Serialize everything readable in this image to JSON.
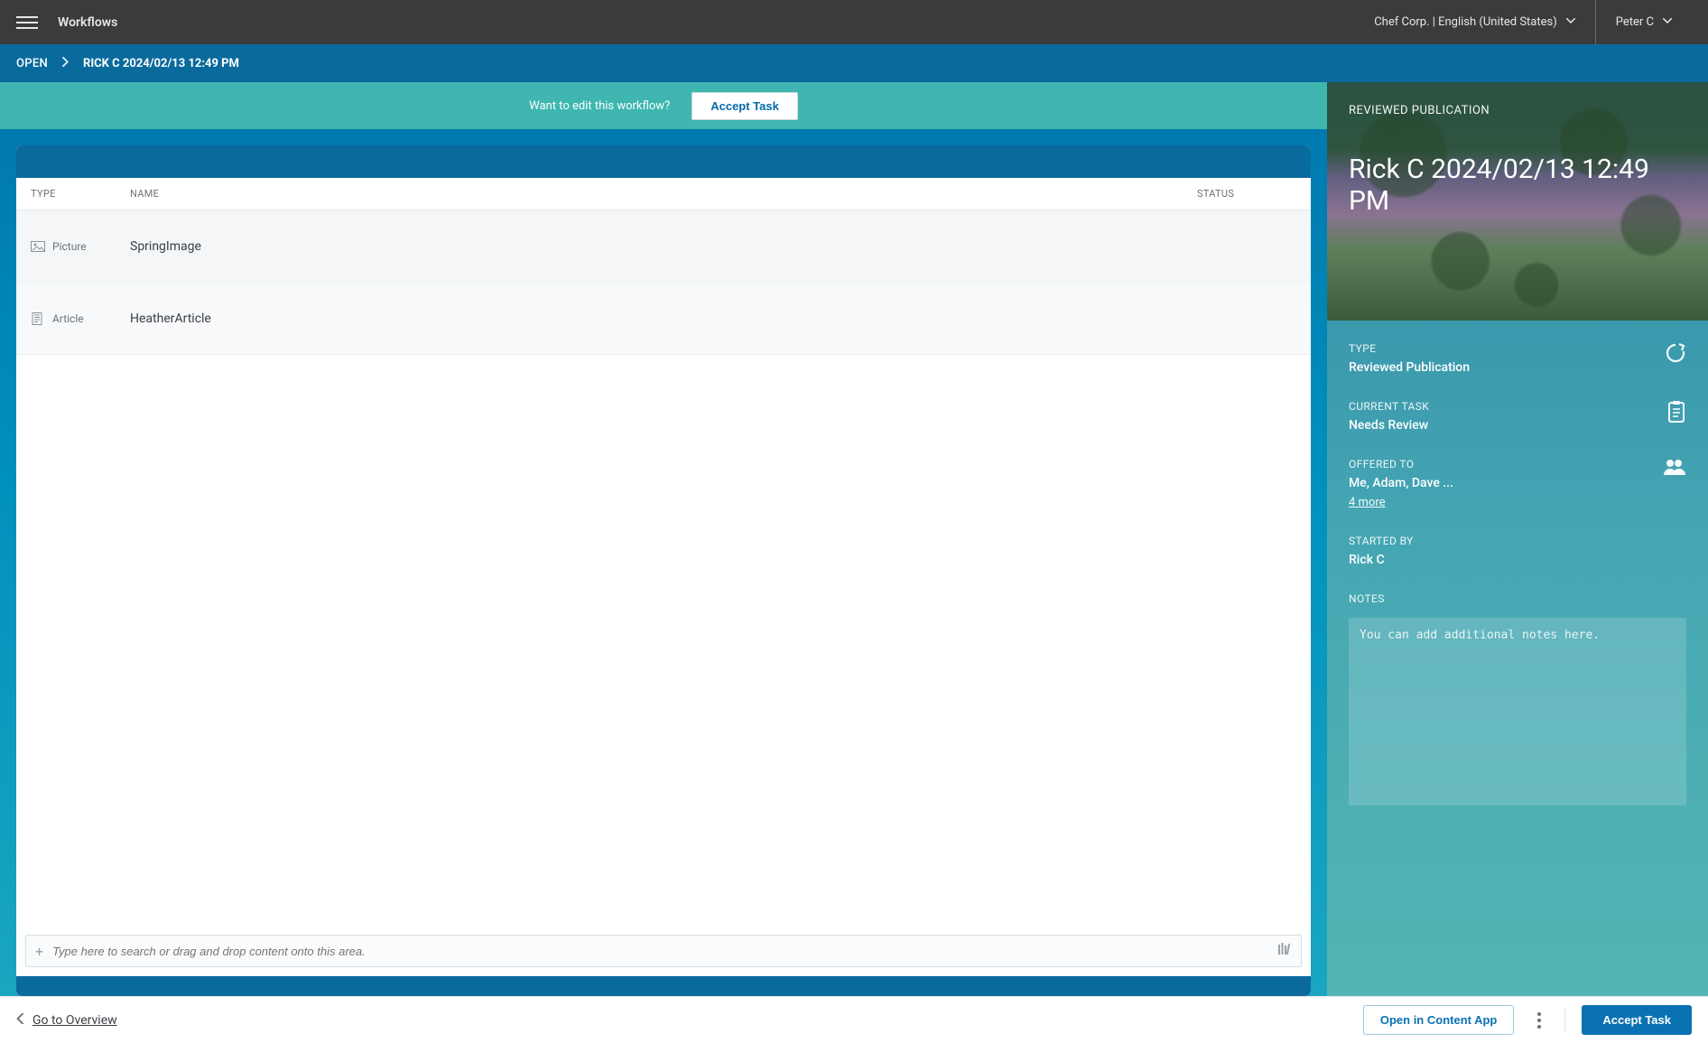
{
  "topbar": {
    "title": "Workflows",
    "org": "Chef Corp. | English (United States)",
    "user": "Peter C"
  },
  "breadcrumb": {
    "open": "OPEN",
    "title": "RICK C 2024/02/13 12:49 PM"
  },
  "banner": {
    "text": "Want to edit this workflow?",
    "accept": "Accept Task"
  },
  "table": {
    "headers": {
      "type": "TYPE",
      "name": "NAME",
      "status": "STATUS"
    },
    "rows": [
      {
        "type": "Picture",
        "name": "SpringImage",
        "status": ""
      },
      {
        "type": "Article",
        "name": "HeatherArticle",
        "status": ""
      }
    ],
    "search_placeholder": "Type here to search or drag and drop content onto this area."
  },
  "sidebar": {
    "eyebrow": "REVIEWED PUBLICATION",
    "title": "Rick C 2024/02/13 12:49 PM",
    "type_label": "TYPE",
    "type_value": "Reviewed Publication",
    "task_label": "CURRENT TASK",
    "task_value": "Needs Review",
    "offered_label": "OFFERED TO",
    "offered_value": "Me, Adam, Dave ...",
    "offered_more": "4 more",
    "started_label": "STARTED BY",
    "started_value": "Rick C",
    "notes_label": "NOTES",
    "notes_placeholder": "You can add additional notes here."
  },
  "footer": {
    "go": "Go to Overview",
    "open_app": "Open in Content App",
    "accept": "Accept Task"
  }
}
